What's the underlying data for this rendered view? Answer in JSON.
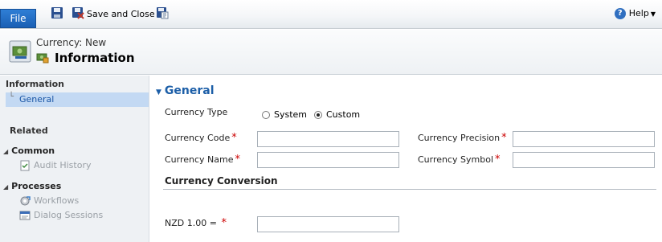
{
  "ribbon": {
    "file_label": "File",
    "save_close_label": "Save and Close",
    "help_label": "Help"
  },
  "header": {
    "kicker": "Currency: New",
    "title": "Information"
  },
  "nav": {
    "information_header": "Information",
    "general_item": "General",
    "related_header": "Related",
    "common_group": "Common",
    "audit_history": "Audit History",
    "processes_group": "Processes",
    "workflows": "Workflows",
    "dialog_sessions": "Dialog Sessions"
  },
  "form": {
    "section_title": "General",
    "currency_type_label": "Currency Type",
    "radio_system": "System",
    "radio_custom": "Custom",
    "selected_type": "Custom",
    "currency_code_label": "Currency Code",
    "currency_code_value": "",
    "currency_precision_label": "Currency Precision",
    "currency_precision_value": "",
    "currency_name_label": "Currency Name",
    "currency_name_value": "",
    "currency_symbol_label": "Currency Symbol",
    "currency_symbol_value": "",
    "conversion_title": "Currency Conversion",
    "rate_label": "NZD 1.00 =",
    "rate_value": "",
    "required_mark": "*"
  },
  "colors": {
    "accent": "#1d5fa8",
    "required": "#cc0000",
    "nav_selected": "#c3d9f3"
  }
}
